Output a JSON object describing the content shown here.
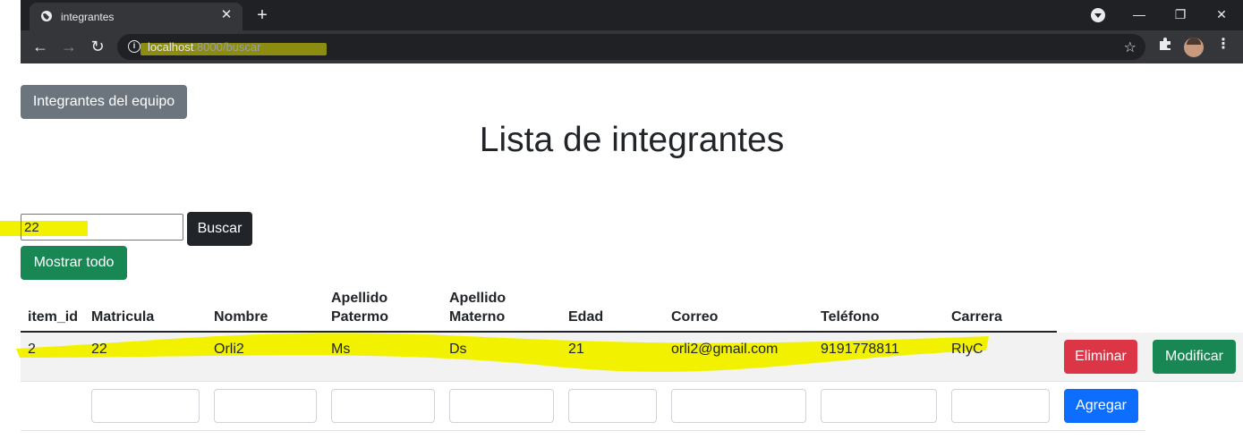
{
  "browser": {
    "tab_title": "integrantes",
    "url_host": "localhost",
    "url_rest": ":8000/buscar"
  },
  "page": {
    "team_button": "Integrantes del equipo",
    "title": "Lista de integrantes",
    "search_value": "22",
    "search_button": "Buscar",
    "show_all_button": "Mostrar todo"
  },
  "table": {
    "headers": {
      "item_id": "item_id",
      "matricula": "Matricula",
      "nombre": "Nombre",
      "apellido_paterno_1": "Apellido",
      "apellido_paterno_2": "Patermo",
      "apellido_materno_1": "Apellido",
      "apellido_materno_2": "Materno",
      "edad": "Edad",
      "correo": "Correo",
      "telefono": "Teléfono",
      "carrera": "Carrera"
    },
    "row": {
      "item_id": "2",
      "matricula": "22",
      "nombre": "Orli2",
      "apellido_paterno": "Ms",
      "apellido_materno": "Ds",
      "edad": "21",
      "correo": "orli2@gmail.com",
      "telefono": "9191778811",
      "carrera": "RIyC"
    },
    "delete_button": "Eliminar",
    "modify_button": "Modificar",
    "add_button": "Agregar"
  },
  "colors": {
    "highlight": "#f2f200",
    "secondary": "#6c757d",
    "dark": "#212529",
    "success": "#198754",
    "danger": "#dc3545",
    "primary": "#0d6efd"
  }
}
